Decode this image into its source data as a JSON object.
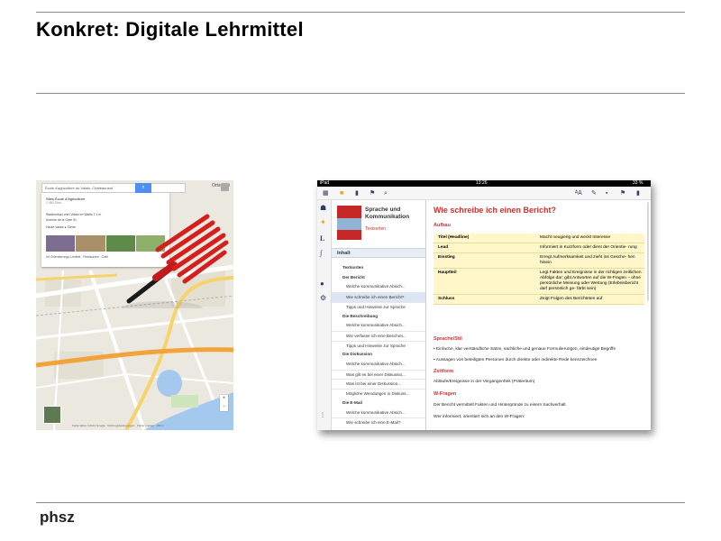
{
  "slide": {
    "title": "Konkret:  Digitale Lehrmittel",
    "footer": "phsz"
  },
  "map": {
    "search_value": "École d'agriculture du Valais, Châteauneuf",
    "card_title": "Sites École d'Agriculture",
    "card_sub": "1 983 Sion",
    "card_row1": "Stadtumbau vom Valais im Wallis 1 1 m",
    "card_row2": "Avenue de la Gare 91",
    "card_row3": "Haute Valais ● Sierre",
    "card_tips": "Ihr Orientierungs-Umfeld · Restaurant · Café",
    "toolbar_label": "Ortsuche",
    "attribution": "Kartendaten ©2014 Google · Nutzungsbedingungen · Fehler melden · 200 m",
    "icons": [
      "search-icon",
      "apps-icon",
      "zoom-plus-icon",
      "zoom-minus-icon",
      "map-pin-icon"
    ]
  },
  "ipad": {
    "status": {
      "left": "iPad",
      "time": "13:26",
      "right": "33 %"
    },
    "book": {
      "title": "Sprache und Kommunikation",
      "subtitle": "Textsorten"
    },
    "toc_header": "Inhalt",
    "toc": [
      {
        "label": "Textsorten",
        "type": "sec"
      },
      {
        "label": "Der Bericht",
        "type": "sec"
      },
      {
        "label": "Welche kommunikative Absich...",
        "type": "sub"
      },
      {
        "label": "Wie schreibe ich einen Bericht?",
        "type": "sub",
        "active": true
      },
      {
        "label": "Tipps und Hinweise zur Sprache",
        "type": "sub"
      },
      {
        "label": "Die Beschreibung",
        "type": "sec"
      },
      {
        "label": "Welche kommunikative Absich...",
        "type": "sub"
      },
      {
        "label": "Wie verfasse ich eine Beschrei...",
        "type": "sub"
      },
      {
        "label": "Tipps und Hinweise zur Sprache",
        "type": "sub"
      },
      {
        "label": "Die Diskussion",
        "type": "sec"
      },
      {
        "label": "Welche kommunikative Absich...",
        "type": "sub"
      },
      {
        "label": "Was gilt es bei einer Diskussio...",
        "type": "sub"
      },
      {
        "label": "Was ist bei einer Diskussion...",
        "type": "sub"
      },
      {
        "label": "Mögliche Wendungen in Diskuss...",
        "type": "sub"
      },
      {
        "label": "Die E-Mail",
        "type": "sec"
      },
      {
        "label": "Welche kommunikative Absich...",
        "type": "sub"
      },
      {
        "label": "Wie schreibe ich eine E-Mail?",
        "type": "sub"
      }
    ],
    "content": {
      "heading": "Wie schreibe ich einen Bericht?",
      "aufbau": "Aufbau",
      "table": [
        [
          "Titel (Headline)",
          "Macht neugierig und weckt Interesse"
        ],
        [
          "Lead",
          "Informiert in Kurzform oder dient der Orientie- rung"
        ],
        [
          "Einstieg",
          "Erregt Aufmerksamkeit und zieht ins Gesche- hen hinein"
        ],
        [
          "Hauptteil",
          "Legt Fakten und Ereignisse in der richtigen zeitlichen Abfolge dar; gibt Antworten auf die W-Fragen – ohne persönliche Meinung oder Wertung (Erlebnisbericht darf persönlich ge- färbt sein)"
        ],
        [
          "Schluss",
          "Zeigt Folgen des Berichteten auf"
        ]
      ],
      "stil_heading": "Sprache/Stil",
      "stil_1": "• Einfache, klar verständliche Sätze, sachliche und genaue Formulierungen, eindeutige Begriffe",
      "stil_2": "• Aussagen von beteiligten Personen durch direkte oder indirekte Rede kennzeichnen",
      "zeitform_heading": "Zeitform",
      "zeitform_text": "Abläufe/Ereignisse in der Vergangenheit (Präteritum)",
      "wfragen_heading": "W-Fragen",
      "wfragen_1": "Der Bericht vermittelt Fakten und Hintergründe zu einem Sachverhalt.",
      "wfragen_2": "Wer informiert, orientiert sich an den W-Fragen:"
    }
  }
}
